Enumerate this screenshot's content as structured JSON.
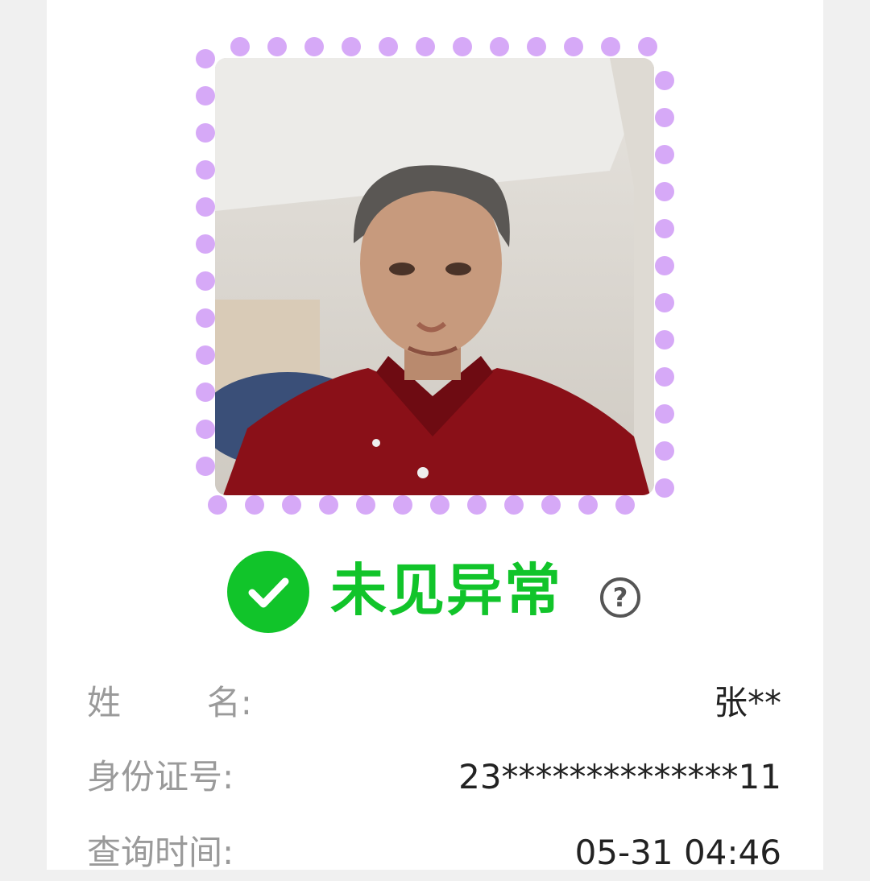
{
  "status": {
    "text": "未见异常",
    "help_glyph": "?",
    "color": "#11c42a",
    "icon": "check-circle-icon"
  },
  "photo": {
    "icon": "person-photo",
    "frame_dot_color": "#d6a9f7"
  },
  "info": {
    "name": {
      "label": "姓        名:",
      "value": "张**"
    },
    "id": {
      "label": "身份证号:",
      "value": "23**************11"
    },
    "time": {
      "label": "查询时间:",
      "value": "05-31 04:46"
    }
  }
}
